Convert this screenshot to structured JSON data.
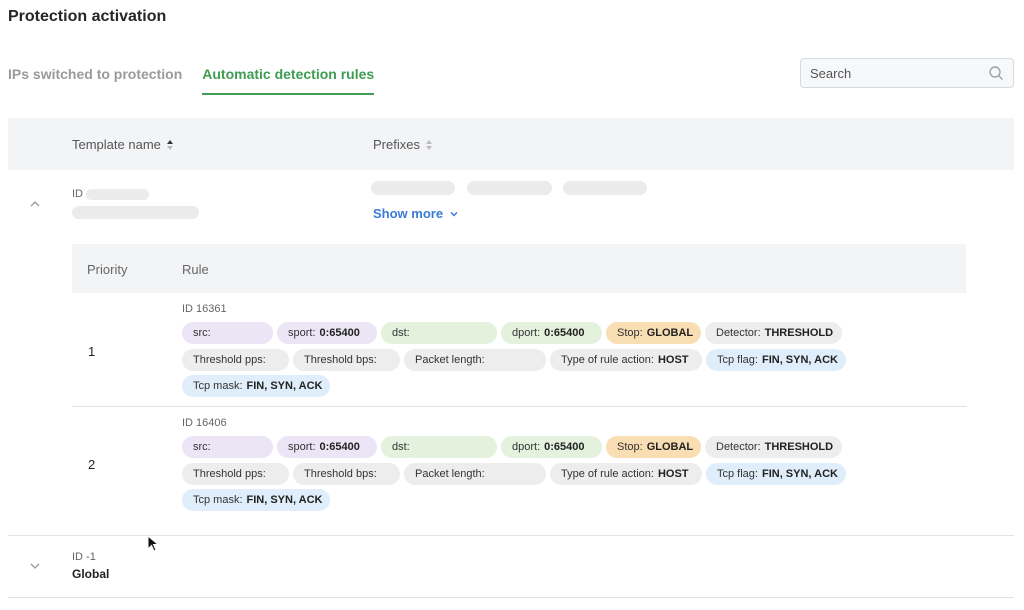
{
  "page": {
    "title": "Protection activation"
  },
  "tabs": [
    {
      "label": "IPs switched to protection",
      "active": false
    },
    {
      "label": "Automatic detection rules",
      "active": true
    }
  ],
  "search": {
    "placeholder": "Search"
  },
  "table": {
    "columns": [
      "Template name",
      "Prefixes"
    ],
    "rows": [
      {
        "id_label": "ID",
        "show_more": "Show more",
        "rules_header": [
          "Priority",
          "Rule"
        ],
        "rules": [
          {
            "priority": "1",
            "id": "ID 16361",
            "line1": [
              {
                "label": "src:",
                "value": "",
                "color": "purple"
              },
              {
                "label": "sport:",
                "value": "0:65400",
                "color": "purple"
              },
              {
                "label": "dst:",
                "value": "",
                "color": "green"
              },
              {
                "label": "dport:",
                "value": "0:65400",
                "color": "green"
              },
              {
                "label": "Stop:",
                "value": "GLOBAL",
                "color": "orange"
              },
              {
                "label": "Detector:",
                "value": "THRESHOLD",
                "color": "gray"
              }
            ],
            "line2": [
              {
                "label": "Threshold pps:",
                "value": "",
                "color": "gray"
              },
              {
                "label": "Threshold bps:",
                "value": "",
                "color": "gray"
              },
              {
                "label": "Packet length:",
                "value": "",
                "color": "gray"
              },
              {
                "label": "Type of rule action:",
                "value": "HOST",
                "color": "gray"
              },
              {
                "label": "Tcp flag:",
                "value": "FIN, SYN, ACK",
                "color": "blue"
              }
            ],
            "line3": [
              {
                "label": "Tcp mask:",
                "value": "FIN, SYN, ACK",
                "color": "blue"
              }
            ]
          },
          {
            "priority": "2",
            "id": "ID 16406",
            "line1": [
              {
                "label": "src:",
                "value": "",
                "color": "purple"
              },
              {
                "label": "sport:",
                "value": "0:65400",
                "color": "purple"
              },
              {
                "label": "dst:",
                "value": "",
                "color": "green"
              },
              {
                "label": "dport:",
                "value": "0:65400",
                "color": "green"
              },
              {
                "label": "Stop:",
                "value": "GLOBAL",
                "color": "orange"
              },
              {
                "label": "Detector:",
                "value": "THRESHOLD",
                "color": "gray"
              }
            ],
            "line2": [
              {
                "label": "Threshold pps:",
                "value": "",
                "color": "gray"
              },
              {
                "label": "Threshold bps:",
                "value": "",
                "color": "gray"
              },
              {
                "label": "Packet length:",
                "value": "",
                "color": "gray"
              },
              {
                "label": "Type of rule action:",
                "value": "HOST",
                "color": "gray"
              },
              {
                "label": "Tcp flag:",
                "value": "FIN, SYN, ACK",
                "color": "blue"
              }
            ],
            "line3": [
              {
                "label": "Tcp mask:",
                "value": "FIN, SYN, ACK",
                "color": "blue"
              }
            ]
          }
        ]
      },
      {
        "id_label": "ID -1",
        "name": "Global"
      }
    ]
  },
  "colors": {
    "accent": "#3e9d52",
    "link": "#3a7bd5"
  }
}
